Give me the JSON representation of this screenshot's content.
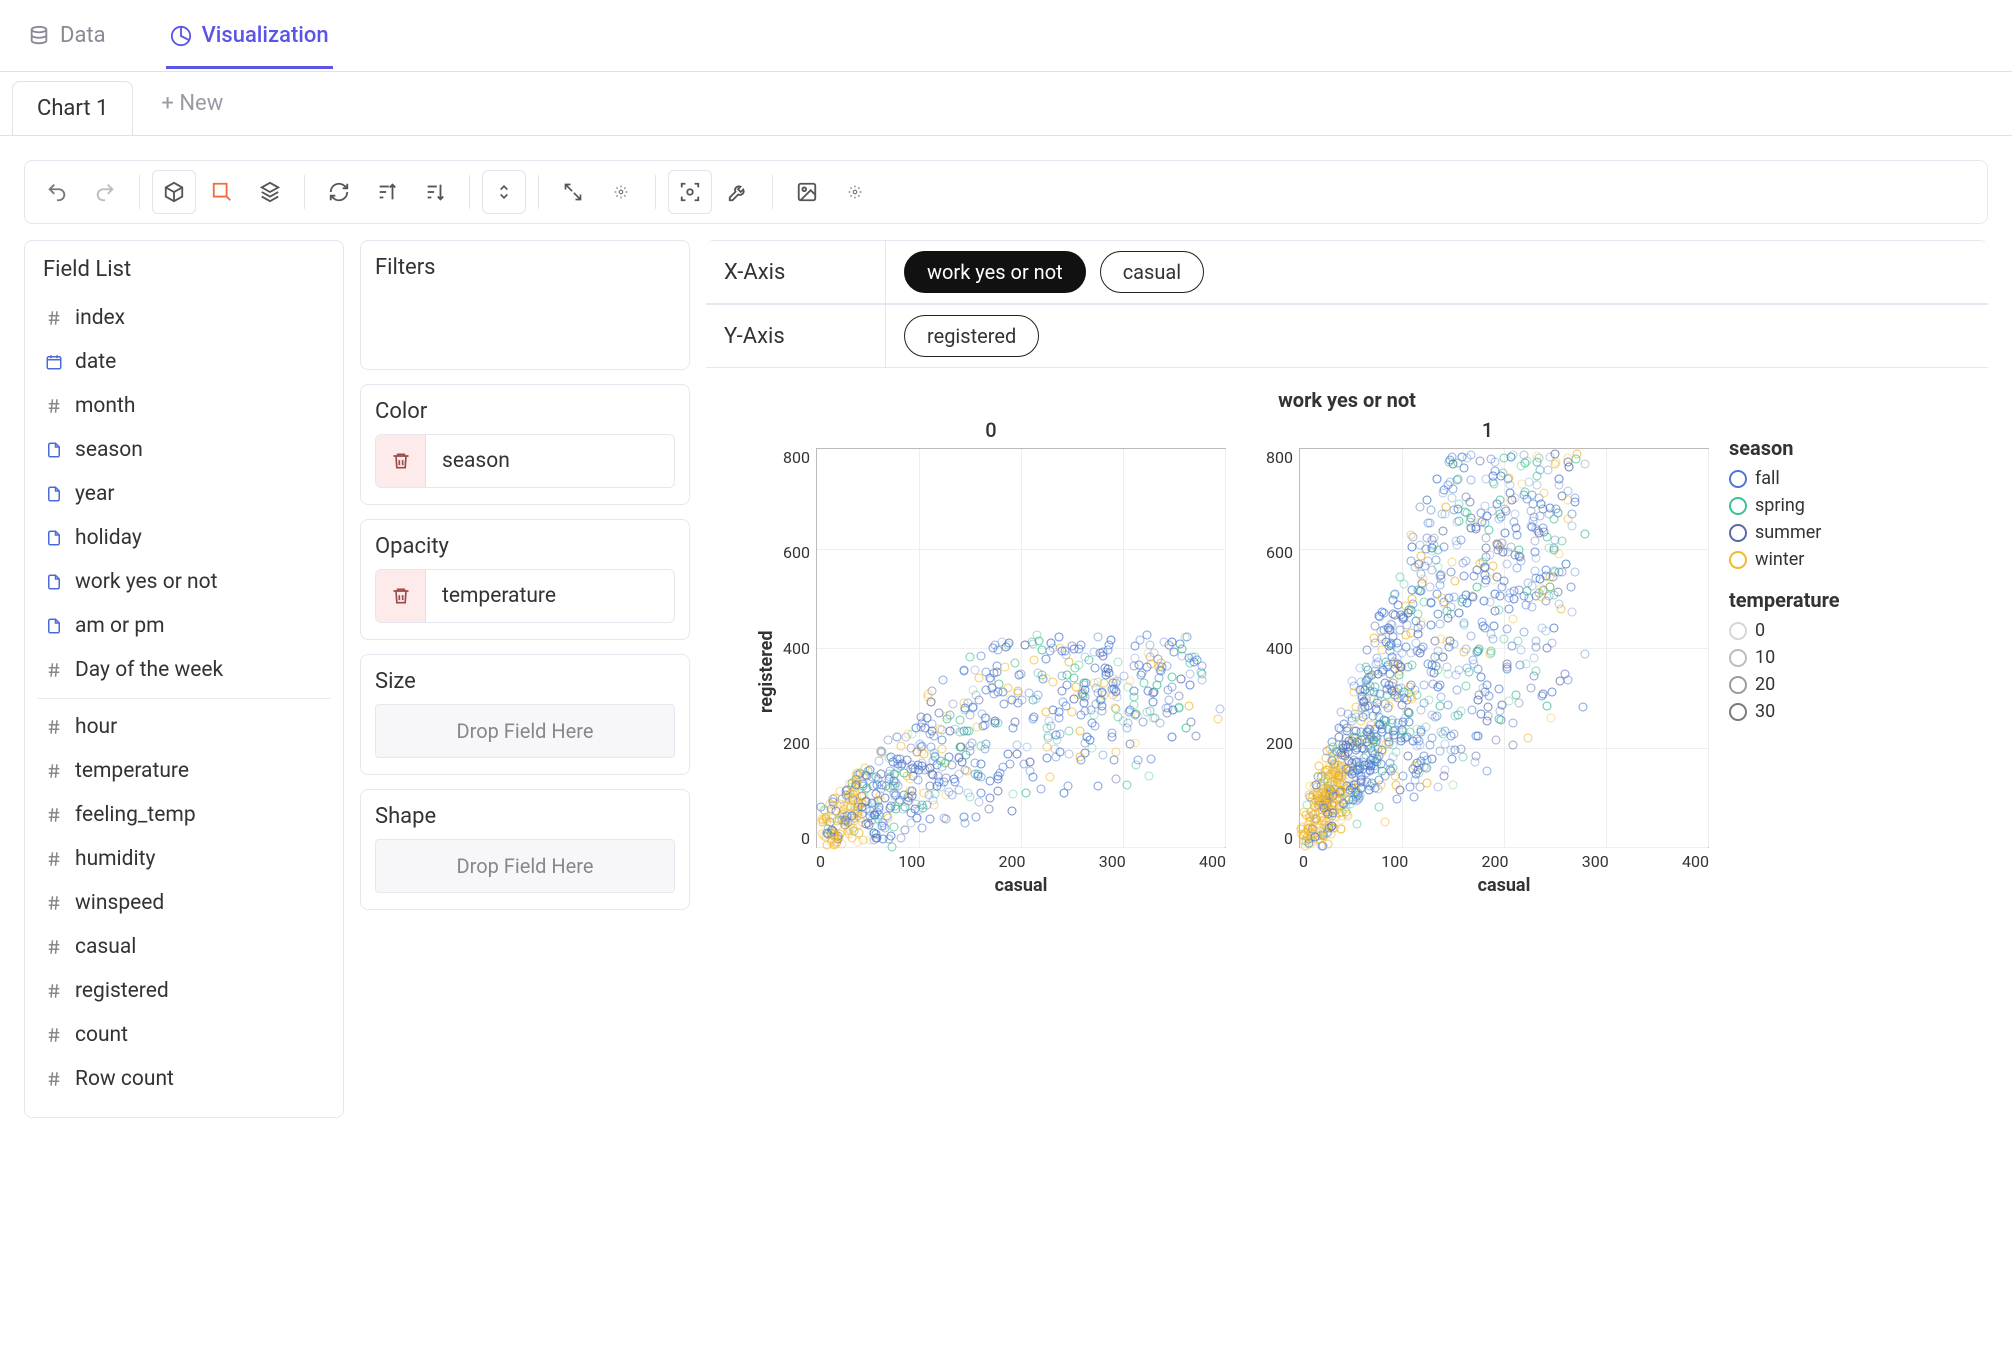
{
  "topnav": {
    "data_label": "Data",
    "viz_label": "Visualization"
  },
  "tabs": {
    "chart1": "Chart 1",
    "new": "+ New"
  },
  "field_list": {
    "title": "Field List",
    "items": [
      {
        "label": "index",
        "type": "num"
      },
      {
        "label": "date",
        "type": "date"
      },
      {
        "label": "month",
        "type": "num"
      },
      {
        "label": "season",
        "type": "cat"
      },
      {
        "label": "year",
        "type": "cat"
      },
      {
        "label": "holiday",
        "type": "cat"
      },
      {
        "label": "work yes or not",
        "type": "cat"
      },
      {
        "label": "am or pm",
        "type": "cat"
      },
      {
        "label": "Day of the week",
        "type": "num"
      }
    ],
    "items2": [
      {
        "label": "hour",
        "type": "num"
      },
      {
        "label": "temperature",
        "type": "num"
      },
      {
        "label": "feeling_temp",
        "type": "num"
      },
      {
        "label": "humidity",
        "type": "num"
      },
      {
        "label": "winspeed",
        "type": "num"
      },
      {
        "label": "casual",
        "type": "num"
      },
      {
        "label": "registered",
        "type": "num"
      },
      {
        "label": "count",
        "type": "num"
      },
      {
        "label": "Row count",
        "type": "num"
      }
    ]
  },
  "encodings": {
    "filters_title": "Filters",
    "color_title": "Color",
    "color_field": "season",
    "opacity_title": "Opacity",
    "opacity_field": "temperature",
    "size_title": "Size",
    "shape_title": "Shape",
    "drop_placeholder": "Drop Field Here"
  },
  "axes": {
    "x_label": "X-Axis",
    "y_label": "Y-Axis",
    "x_pills": [
      "work yes or not",
      "casual"
    ],
    "y_pills": [
      "registered"
    ]
  },
  "chart_data": {
    "type": "scatter",
    "facet_field": "work yes or not",
    "facets": [
      "0",
      "1"
    ],
    "title": "work yes or not",
    "xlabel": "casual",
    "ylabel": "registered",
    "x_ticks": [
      0,
      100,
      200,
      300,
      400
    ],
    "y_ticks": [
      0,
      200,
      400,
      600,
      800
    ],
    "xlim": [
      0,
      420
    ],
    "ylim": [
      0,
      880
    ],
    "color_field": "season",
    "color_legend": [
      {
        "name": "fall",
        "color": "#4a7ad6"
      },
      {
        "name": "spring",
        "color": "#3fc28f"
      },
      {
        "name": "summer",
        "color": "#5a6aa8"
      },
      {
        "name": "winter",
        "color": "#f2b92e"
      }
    ],
    "opacity_field": "temperature",
    "opacity_legend": [
      {
        "name": "0",
        "color": "#d6d6d6"
      },
      {
        "name": "10",
        "color": "#bcbcbc"
      },
      {
        "name": "20",
        "color": "#9c9c9c"
      },
      {
        "name": "30",
        "color": "#7a7a7a"
      }
    ],
    "points_note": "Dense scatter; point clouds concentrated near x=0–100 in both facets. Facet 0: registered mostly 0–450, casual 0–400. Facet 1: registered 0–870, casual 0–300 with outliers."
  }
}
